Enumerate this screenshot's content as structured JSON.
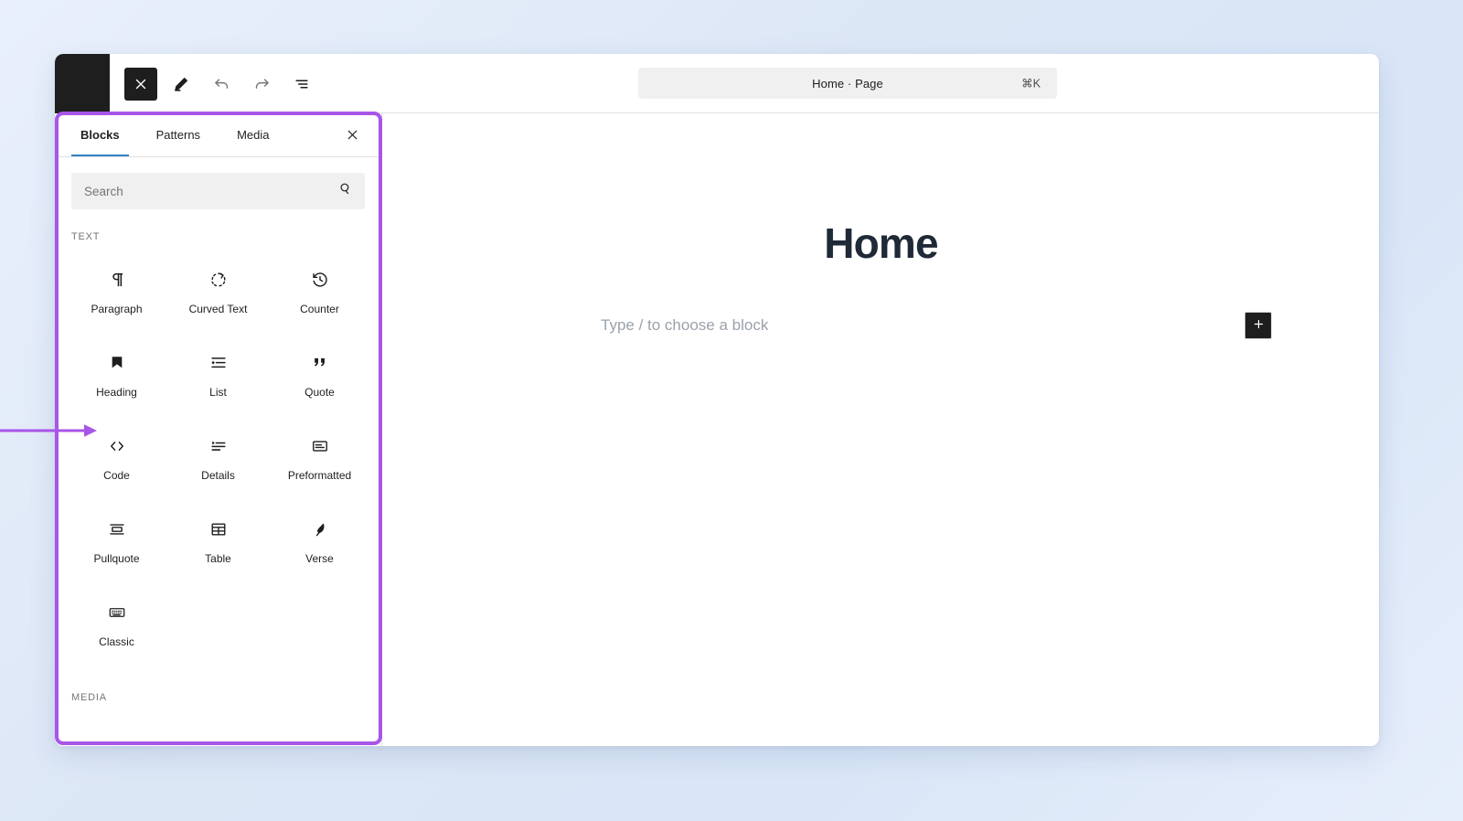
{
  "header": {
    "toolbar": [
      {
        "name": "close-inserter-button",
        "icon": "close-x-icon",
        "state": "active",
        "label": ""
      },
      {
        "name": "edit-mode-button",
        "icon": "pencil-icon",
        "state": "default",
        "label": ""
      },
      {
        "name": "undo-button",
        "icon": "undo-arrow-icon",
        "state": "muted",
        "label": ""
      },
      {
        "name": "redo-button",
        "icon": "redo-arrow-icon",
        "state": "muted",
        "label": ""
      },
      {
        "name": "document-overview-button",
        "icon": "list-view-icon",
        "state": "default",
        "label": ""
      }
    ],
    "command_bar": {
      "title": "Home · Page",
      "shortcut": "⌘K"
    }
  },
  "inserter": {
    "tabs": [
      {
        "label": "Blocks",
        "active": true
      },
      {
        "label": "Patterns",
        "active": false
      },
      {
        "label": "Media",
        "active": false
      }
    ],
    "close_label": "×",
    "search": {
      "placeholder": "Search",
      "value": ""
    },
    "categories": [
      {
        "label": "TEXT",
        "blocks": [
          {
            "label": "Paragraph",
            "icon": "pilcrow-icon"
          },
          {
            "label": "Curved Text",
            "icon": "curved-text-icon"
          },
          {
            "label": "Counter",
            "icon": "counter-clock-icon"
          },
          {
            "label": "Heading",
            "icon": "heading-bookmark-icon"
          },
          {
            "label": "List",
            "icon": "list-icon"
          },
          {
            "label": "Quote",
            "icon": "quote-marks-icon"
          },
          {
            "label": "Code",
            "icon": "code-brackets-icon"
          },
          {
            "label": "Details",
            "icon": "details-icon"
          },
          {
            "label": "Preformatted",
            "icon": "preformatted-icon"
          },
          {
            "label": "Pullquote",
            "icon": "pullquote-icon"
          },
          {
            "label": "Table",
            "icon": "table-grid-icon"
          },
          {
            "label": "Verse",
            "icon": "verse-feather-icon"
          },
          {
            "label": "Classic",
            "icon": "keyboard-icon"
          }
        ]
      },
      {
        "label": "MEDIA",
        "blocks": []
      }
    ]
  },
  "canvas": {
    "page_title": "Home",
    "placeholder": "Type / to choose a block",
    "add_block_label": "+"
  },
  "annotation": {
    "color": "#a855e8",
    "target": "inserter-panel"
  },
  "theme": {
    "accent_blue": "#3582c4",
    "dark": "#1e1e1e",
    "panel_bg": "#ffffff",
    "field_bg": "#f0f0f0",
    "canvas_title_color": "#1f2937",
    "page_background": "#dce7f6"
  }
}
